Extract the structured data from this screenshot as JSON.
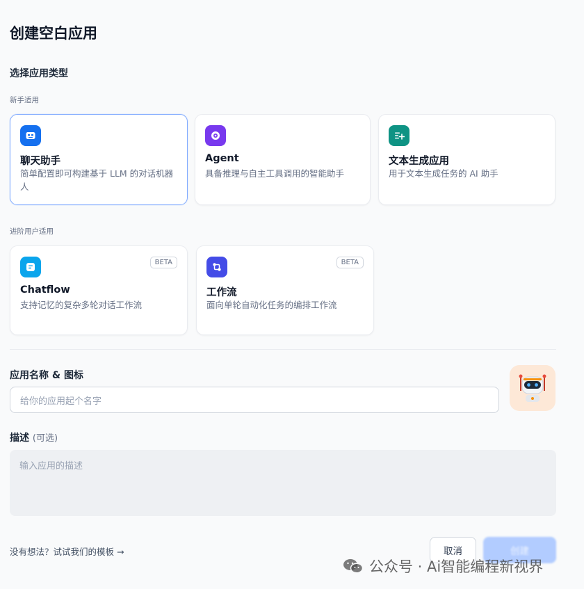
{
  "title": "创建空白应用",
  "type_section": {
    "label": "选择应用类型",
    "beginner_group": "新手适用",
    "advanced_group": "进阶用户适用",
    "beginner_cards": [
      {
        "name": "聊天助手",
        "desc": "简单配置即可构建基于 LLM 的对话机器人",
        "icon": "chat-bot-icon",
        "color": "#1570ef"
      },
      {
        "name": "Agent",
        "desc": "具备推理与自主工具调用的智能助手",
        "icon": "agent-icon",
        "color": "#7839ee"
      },
      {
        "name": "文本生成应用",
        "desc": "用于文本生成任务的 AI 助手",
        "icon": "text-generation-icon",
        "color": "#0e9384"
      }
    ],
    "advanced_cards": [
      {
        "name": "Chatflow",
        "desc": "支持记忆的复杂多轮对话工作流",
        "badge": "BETA",
        "icon": "chatflow-icon",
        "color": "#0ba5ec"
      },
      {
        "name": "工作流",
        "desc": "面向单轮自动化任务的编排工作流",
        "badge": "BETA",
        "icon": "workflow-icon",
        "color": "#444ce7"
      }
    ]
  },
  "name_field": {
    "label": "应用名称 & 图标",
    "placeholder": "给你的应用起个名字",
    "avatar_icon": "robot-icon"
  },
  "desc_field": {
    "label": "描述",
    "optional": "(可选)",
    "placeholder": "输入应用的描述"
  },
  "footer": {
    "template_link": "没有想法？试试我们的模板 →",
    "cancel": "取消",
    "create": "创建"
  },
  "watermark": "公众号 · Ai智能编程新视界",
  "colors": {
    "selected_border": "#84adff",
    "primary_disabled": "#b2ccff"
  }
}
